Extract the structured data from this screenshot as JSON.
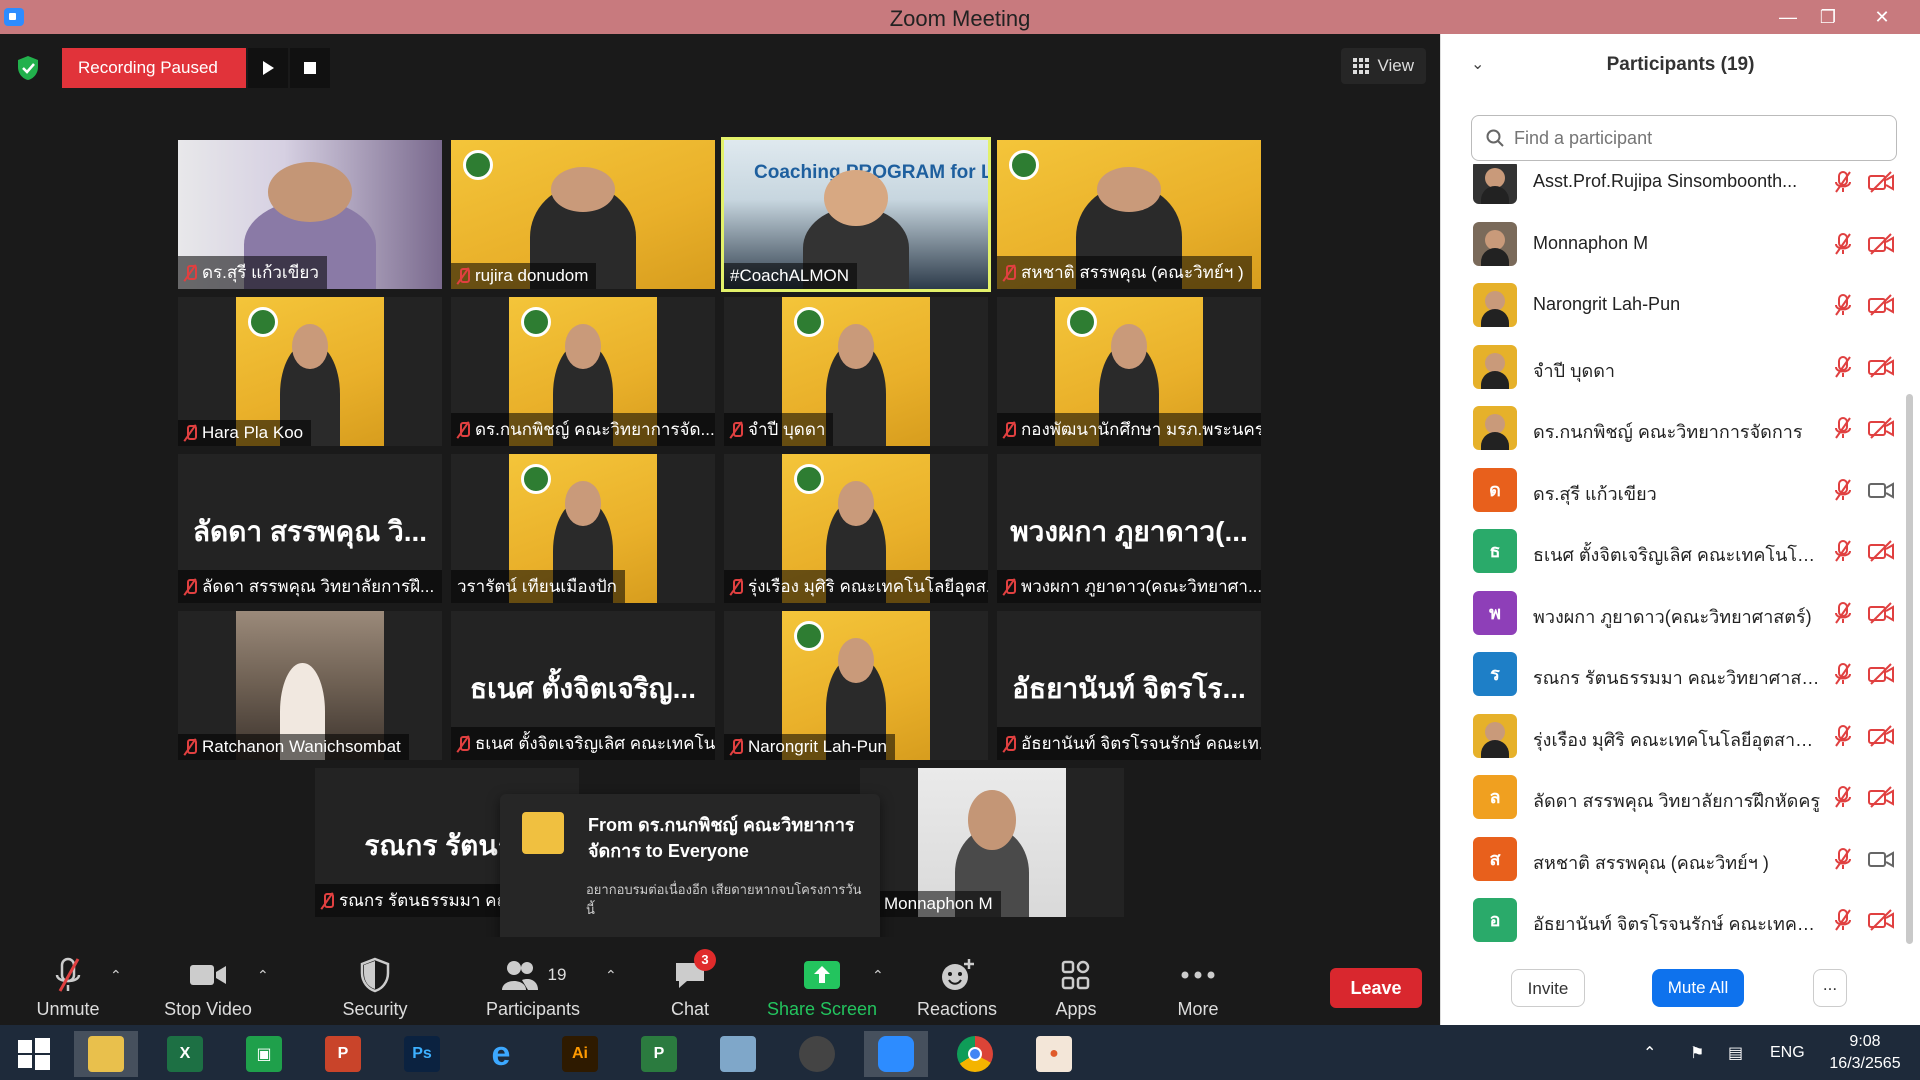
{
  "window": {
    "title": "Zoom Meeting"
  },
  "recording": {
    "label": "Recording Paused"
  },
  "view_button": {
    "label": "View"
  },
  "tiles": [
    {
      "name": "ดร.สุรี  แก้วเขียว",
      "kind": "video-person"
    },
    {
      "name": "rujira donudom",
      "kind": "video-poster"
    },
    {
      "name": "#CoachALMON",
      "kind": "video-coach",
      "speaking": true,
      "overlay": "Coaching PROGRAM for Lecturer"
    },
    {
      "name": "สหชาติ สรรพคุณ (คณะวิทย์ฯ )",
      "kind": "video-poster"
    },
    {
      "name": "Hara Pla Koo",
      "kind": "video-poster"
    },
    {
      "name": "ดร.กนกพิชญ์ คณะวิทยาการจัด...",
      "kind": "video-poster"
    },
    {
      "name": "จำปี บุดดา",
      "kind": "video-poster"
    },
    {
      "name": "กองพัฒนานักศึกษา มรภ.พระนคร",
      "kind": "video-poster"
    },
    {
      "name": "ลัดดา สรรพคุณ วิทยาลัยการฝึ...",
      "kind": "name-only",
      "big": "ลัดดา สรรพคุณ วิ..."
    },
    {
      "name": "วรารัตน์ เทียนเมืองปัก",
      "kind": "video-poster"
    },
    {
      "name": "รุ่งเรือง มุศิริ คณะเทคโนโลยีอุตส...",
      "kind": "video-poster"
    },
    {
      "name": "พวงผกา ภูยาดาว(คณะวิทยาศา...",
      "kind": "name-only",
      "big": "พวงผกา ภูยาดาว(..."
    },
    {
      "name": "Ratchanon Wanichsombat",
      "kind": "video-photo"
    },
    {
      "name": "ธเนศ ตั้งจิตเจริญเลิศ คณะเทคโน...",
      "kind": "name-only",
      "big": "ธเนศ ตั้งจิตเจริญ..."
    },
    {
      "name": "Narongrit Lah-Pun",
      "kind": "video-poster"
    },
    {
      "name": "อัธยานันท์ จิตรโรจนรักษ์ คณะเท...",
      "kind": "name-only",
      "big": "อัธยานันท์ จิตรโร..."
    },
    {
      "name": "รณกร รัตนธรรมมา คณ",
      "kind": "name-only",
      "big": "รณกร รัตนธร"
    },
    {
      "name": "Monnaphon M",
      "kind": "video-person"
    }
  ],
  "chat_popup": {
    "from": "From ดร.กนกพิชญ์ คณะวิทยาการจัดการ to Everyone",
    "message": "อยากอบรมต่อเนื่องอีก เสียดายหากจบโครงการวันนี้"
  },
  "toolbar": {
    "unmute": "Unmute",
    "stop_video": "Stop Video",
    "security": "Security",
    "participants": "Participants",
    "participants_count": "19",
    "chat": "Chat",
    "chat_badge": "3",
    "share_screen": "Share Screen",
    "reactions": "Reactions",
    "apps": "Apps",
    "more": "More",
    "leave": "Leave"
  },
  "panel": {
    "title": "Participants (19)",
    "search_placeholder": "Find a participant",
    "participants": [
      {
        "name": "Asst.Prof.Rujipa Sinsomboonth...",
        "initial": "",
        "color": "#333",
        "cam": "off"
      },
      {
        "name": "Monnaphon M",
        "initial": "",
        "color": "#7a6a5a",
        "cam": "off"
      },
      {
        "name": "Narongrit Lah-Pun",
        "initial": "",
        "color": "#e6b12a",
        "cam": "off"
      },
      {
        "name": "จำปี บุดดา",
        "initial": "",
        "color": "#e6b12a",
        "cam": "off"
      },
      {
        "name": "ดร.กนกพิชญ์ คณะวิทยาการจัดการ",
        "initial": "",
        "color": "#e6b12a",
        "cam": "off"
      },
      {
        "name": "ดร.สุรี  แก้วเขียว",
        "initial": "ด",
        "color": "#e8601c",
        "cam": "on"
      },
      {
        "name": "ธเนศ ตั้งจิตเจริญเลิศ คณะเทคโนโลยีอุ...",
        "initial": "ธ",
        "color": "#2aaa6a",
        "cam": "off"
      },
      {
        "name": "พวงผกา ภูยาดาว(คณะวิทยาศาสตร์)",
        "initial": "พ",
        "color": "#8e3fb8",
        "cam": "off"
      },
      {
        "name": "รณกร รัตนธรรมมา คณะวิทยาศาสตร์ฯ",
        "initial": "ร",
        "color": "#1e7fc7",
        "cam": "off"
      },
      {
        "name": "รุ่งเรือง มุศิริ คณะเทคโนโลยีอุตสาหกรรม",
        "initial": "",
        "color": "#e6b12a",
        "cam": "off"
      },
      {
        "name": "ลัดดา สรรพคุณ วิทยาลัยการฝึกหัดครู",
        "initial": "ล",
        "color": "#f0a020",
        "cam": "off"
      },
      {
        "name": "สหชาติ สรรพคุณ (คณะวิทย์ฯ )",
        "initial": "ส",
        "color": "#e8601c",
        "cam": "on"
      },
      {
        "name": "อัธยานันท์ จิตรโรจนรักษ์ คณะเทคโนโลยี...",
        "initial": "อ",
        "color": "#2aaa6a",
        "cam": "off"
      }
    ],
    "invite": "Invite",
    "mute_all": "Mute All",
    "more": "..."
  },
  "taskbar": {
    "lang": "ENG",
    "time": "9:08",
    "date": "16/3/2565"
  }
}
